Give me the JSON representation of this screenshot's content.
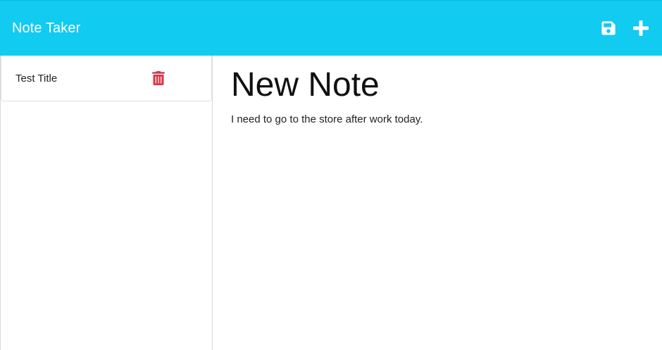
{
  "navbar": {
    "brand": "Note Taker",
    "icons": [
      "save-icon",
      "plus-icon"
    ],
    "background": "#11cbf0"
  },
  "sidebar": {
    "notes": [
      {
        "title": "Test Title",
        "delete_icon": "trash-icon",
        "delete_color": "#dc3545"
      }
    ]
  },
  "editor": {
    "title": "New Note",
    "body": "I need to go to the store after work today."
  }
}
